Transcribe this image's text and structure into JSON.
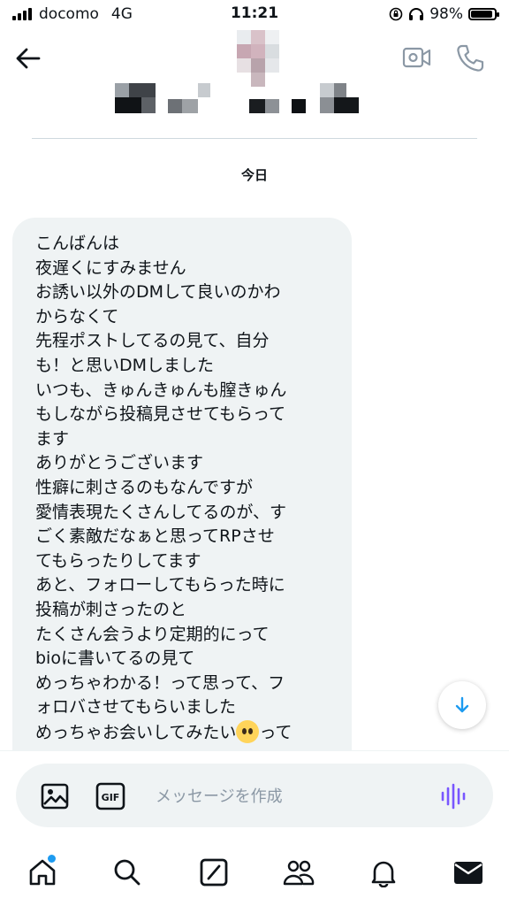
{
  "status_bar": {
    "carrier": "docomo",
    "network": "4G",
    "time": "11:21",
    "battery": "98%"
  },
  "header": {
    "back_icon": "arrow-left-icon",
    "video_icon": "video-camera-icon",
    "phone_icon": "phone-icon"
  },
  "thread": {
    "date_label": "今日",
    "message_lines": [
      "こんばんは",
      "夜遅くにすみません",
      "お誘い以外のDMして良いのかわ",
      "からなくて",
      "先程ポストしてるの見て、自分",
      "も！と思いDMしました",
      "いつも、きゅんきゅんも膣きゅん",
      "もしながら投稿見させてもらって",
      "ます",
      "ありがとうございます",
      "性癖に刺さるのもなんですが",
      "愛情表現たくさんしてるのが、す",
      "ごく素敵だなぁと思ってRPさせ",
      "てもらったりしてます",
      "あと、フォローしてもらった時に",
      "投稿が刺さったのと",
      "たくさん会うより定期的にって",
      "bioに書いてるの見て",
      "めっちゃわかる！って思って、フ",
      "ォロバさせてもらいました",
      "めっちゃお会いしてみたい",
      "って"
    ],
    "scroll_down_icon": "arrow-down-icon"
  },
  "composer": {
    "placeholder": "メッセージを作成",
    "image_icon": "image-icon",
    "gif_label": "GIF",
    "voice_icon": "voice-waveform-icon"
  },
  "tabbar": {
    "items": [
      "home-icon",
      "search-icon",
      "grok-icon",
      "communities-icon",
      "notifications-icon",
      "messages-icon"
    ]
  },
  "colors": {
    "accent": "#1d9bf0",
    "voice_accent": "#7856ff",
    "bubble_bg": "#eff3f4",
    "text": "#0f1419",
    "muted": "#8b98a5"
  }
}
